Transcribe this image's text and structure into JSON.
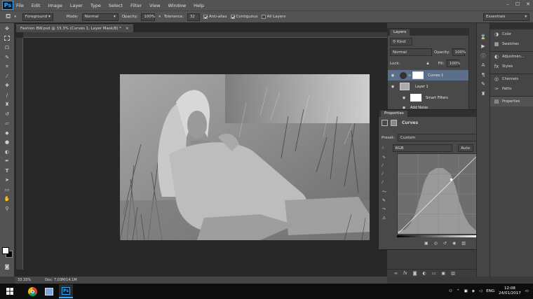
{
  "app_logo": "Ps",
  "menu": [
    "File",
    "Edit",
    "Image",
    "Layer",
    "Type",
    "Select",
    "Filter",
    "View",
    "Window",
    "Help"
  ],
  "window_controls": [
    "–",
    "☐",
    "✕"
  ],
  "options_bar": {
    "sample_select": "Foreground",
    "mode_label": "Mode:",
    "mode_value": "Normal",
    "opacity_label": "Opacity:",
    "opacity_value": "100%",
    "tolerance_label": "Tolerance:",
    "tolerance_value": "32",
    "antialias_label": "Anti-alias",
    "contiguous_label": "Contiguous",
    "all_layers_label": "All Layers",
    "workspace": "Essentials"
  },
  "document": {
    "tab_title": "Fashion BW.psd @ 33.3% (Curves 1, Layer Mask/8) *",
    "zoom": "33.33%",
    "doc_info": "Doc: 7.03M/14.1M"
  },
  "layers_panel": {
    "tab": "Layers",
    "kind_label": "Kind",
    "blend_mode": "Normal",
    "opacity_label": "Opacity:",
    "opacity_value": "100%",
    "lock_label": "Lock:",
    "fill_label": "Fill:",
    "fill_value": "100%",
    "layers": [
      {
        "name": "Curves 1"
      },
      {
        "name": "Layer 1"
      },
      {
        "name": "Smart Filters"
      },
      {
        "name": "Add Noise"
      }
    ]
  },
  "properties_panel": {
    "tab": "Properties",
    "type_label": "Curves",
    "preset_label": "Preset:",
    "preset_value": "Custom",
    "channel_value": "RGB",
    "auto_button": "Auto"
  },
  "right_dock": [
    {
      "icon": "color-icon",
      "label": "Color"
    },
    {
      "icon": "swatches-icon",
      "label": "Swatches"
    },
    {
      "icon": "adjustments-icon",
      "label": "Adjustmen..."
    },
    {
      "icon": "styles-icon",
      "label": "Styles"
    },
    {
      "icon": "channels-icon",
      "label": "Channels"
    },
    {
      "icon": "paths-icon",
      "label": "Paths"
    },
    {
      "icon": "properties-icon",
      "label": "Properties"
    }
  ],
  "taskbar": {
    "language": "ENG",
    "time": "12:08",
    "date": "24/01/2017"
  },
  "colors": {
    "ps_blue": "#31a8ff",
    "selected_layer": "#5b6f8a",
    "ui_bg": "#535353"
  }
}
